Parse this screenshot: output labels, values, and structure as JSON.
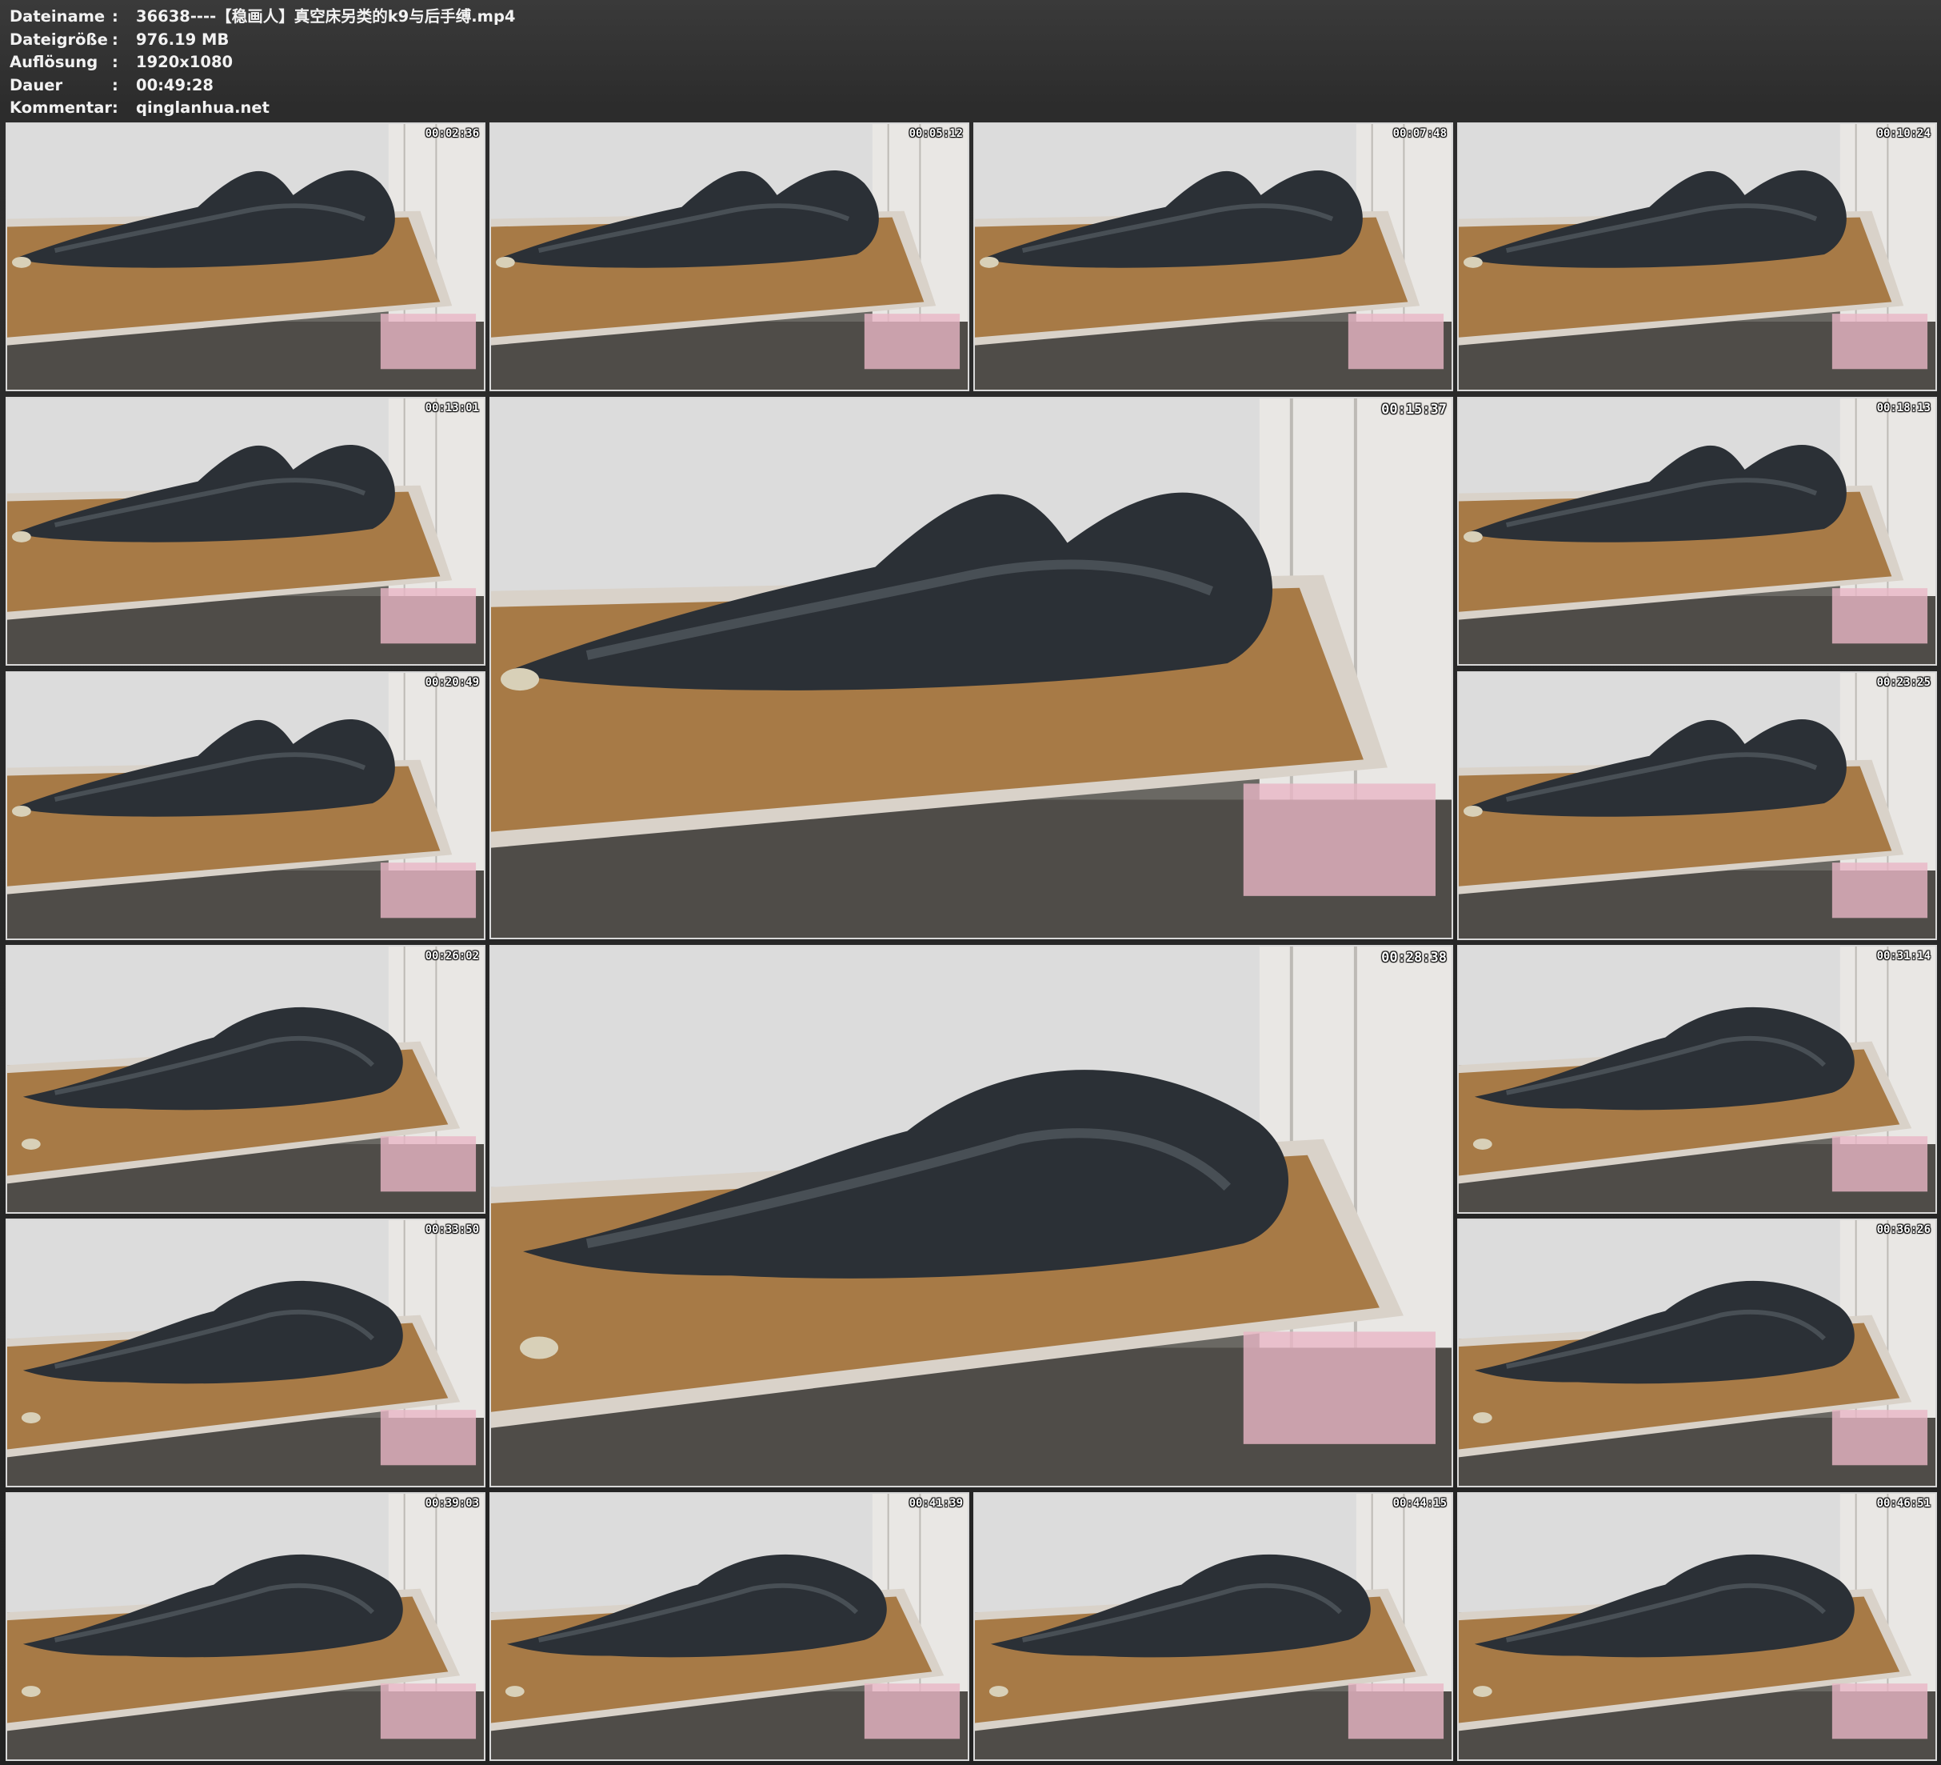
{
  "info": {
    "rows": [
      {
        "key": "Dateiname",
        "sep": ":",
        "value": "36638----【稳画人】真空床另类的k9与后手缚.mp4"
      },
      {
        "key": "Dateigröße",
        "sep": ":",
        "value": "976.19 MB"
      },
      {
        "key": "Auflösung",
        "sep": ":",
        "value": "1920x1080"
      },
      {
        "key": "Dauer",
        "sep": ":",
        "value": "00:49:28"
      },
      {
        "key": "Kommentar",
        "sep": ":",
        "value": "qinglanhua.net"
      }
    ]
  },
  "thumbnails": [
    {
      "timestamp": "00:02:36"
    },
    {
      "timestamp": "00:05:12"
    },
    {
      "timestamp": "00:07:48"
    },
    {
      "timestamp": "00:10:24"
    },
    {
      "timestamp": "00:13:01"
    },
    {
      "timestamp": "00:15:37"
    },
    {
      "timestamp": "00:18:13"
    },
    {
      "timestamp": "00:20:49"
    },
    {
      "timestamp": "00:23:25"
    },
    {
      "timestamp": "00:26:02"
    },
    {
      "timestamp": "00:28:38"
    },
    {
      "timestamp": "00:31:14"
    },
    {
      "timestamp": "00:33:50"
    },
    {
      "timestamp": "00:36:26"
    },
    {
      "timestamp": "00:39:03"
    },
    {
      "timestamp": "00:41:39"
    },
    {
      "timestamp": "00:44:15"
    },
    {
      "timestamp": "00:46:51"
    }
  ],
  "colors": {
    "background": "#262626",
    "text": "#f2f2f2",
    "frame_border": "#d8d8d8"
  }
}
